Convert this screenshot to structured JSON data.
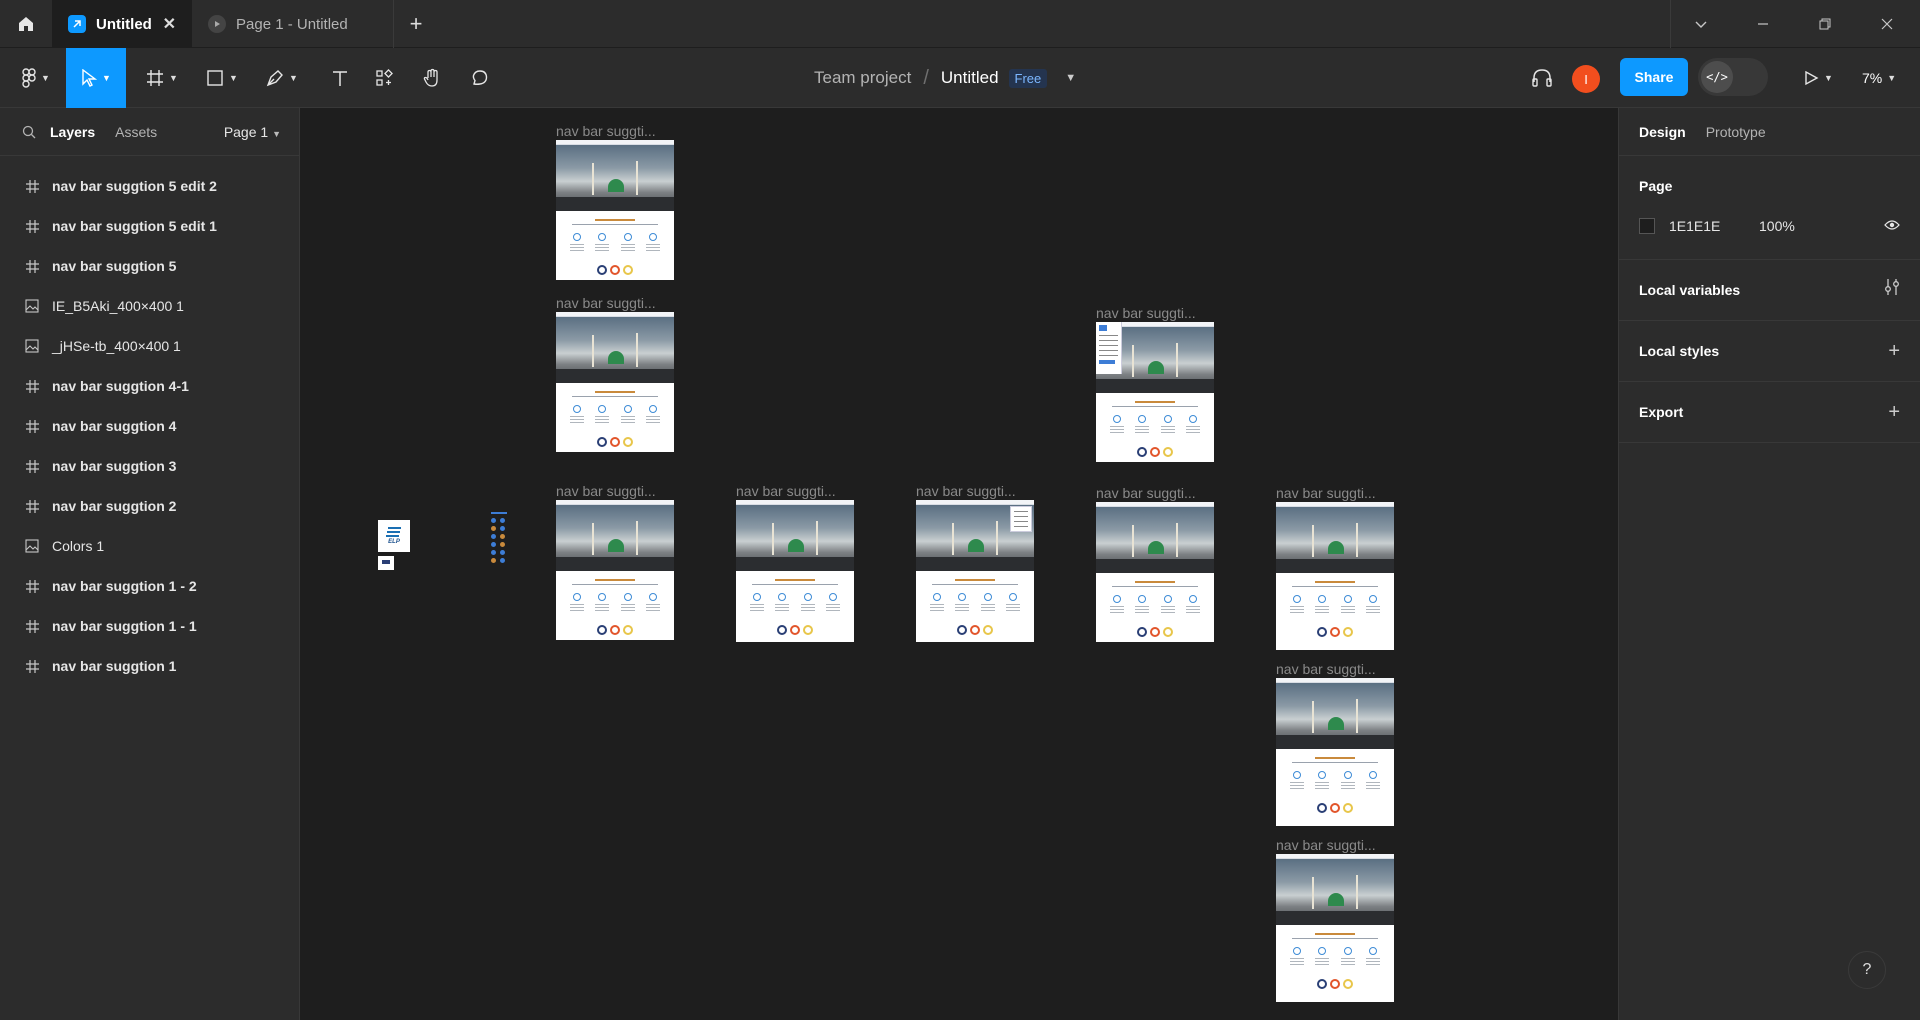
{
  "tabs": {
    "active_label": "Untitled",
    "inactive_label": "Page 1 - Untitled"
  },
  "toolbar": {
    "team": "Team project",
    "separator": "/",
    "file": "Untitled",
    "plan_badge": "Free",
    "avatar_initial": "I",
    "share_label": "Share",
    "dev_mode_glyph": "</>",
    "zoom": "7%"
  },
  "left_panel": {
    "tab_layers": "Layers",
    "tab_assets": "Assets",
    "page_selector": "Page 1",
    "layers": [
      {
        "label": "nav bar suggtion 5 edit 2",
        "type": "frame"
      },
      {
        "label": "nav bar suggtion 5 edit 1",
        "type": "frame"
      },
      {
        "label": "nav bar suggtion 5",
        "type": "frame"
      },
      {
        "label": "IE_B5Aki_400×400 1",
        "type": "image"
      },
      {
        "label": "_jHSe-tb_400×400 1",
        "type": "image"
      },
      {
        "label": "nav bar suggtion 4-1",
        "type": "frame"
      },
      {
        "label": "nav bar suggtion 4",
        "type": "frame"
      },
      {
        "label": "nav bar suggtion 3",
        "type": "frame"
      },
      {
        "label": "nav bar suggtion 2",
        "type": "frame"
      },
      {
        "label": "Colors 1",
        "type": "image"
      },
      {
        "label": "nav bar suggtion 1 - 2",
        "type": "frame"
      },
      {
        "label": "nav bar suggtion 1 - 1",
        "type": "frame"
      },
      {
        "label": "nav bar suggtion 1",
        "type": "frame"
      }
    ]
  },
  "canvas": {
    "frame_label": "nav bar suggti...",
    "logo_text": "ELP"
  },
  "right_panel": {
    "tab_design": "Design",
    "tab_prototype": "Prototype",
    "page_title": "Page",
    "page_fill_hex": "1E1E1E",
    "page_fill_opacity": "100%",
    "local_variables": "Local variables",
    "local_styles": "Local styles",
    "export": "Export",
    "help": "?"
  },
  "colors": {
    "accent": "#0d99ff",
    "avatar": "#f24e1e",
    "page_fill": "#1e1e1e"
  }
}
